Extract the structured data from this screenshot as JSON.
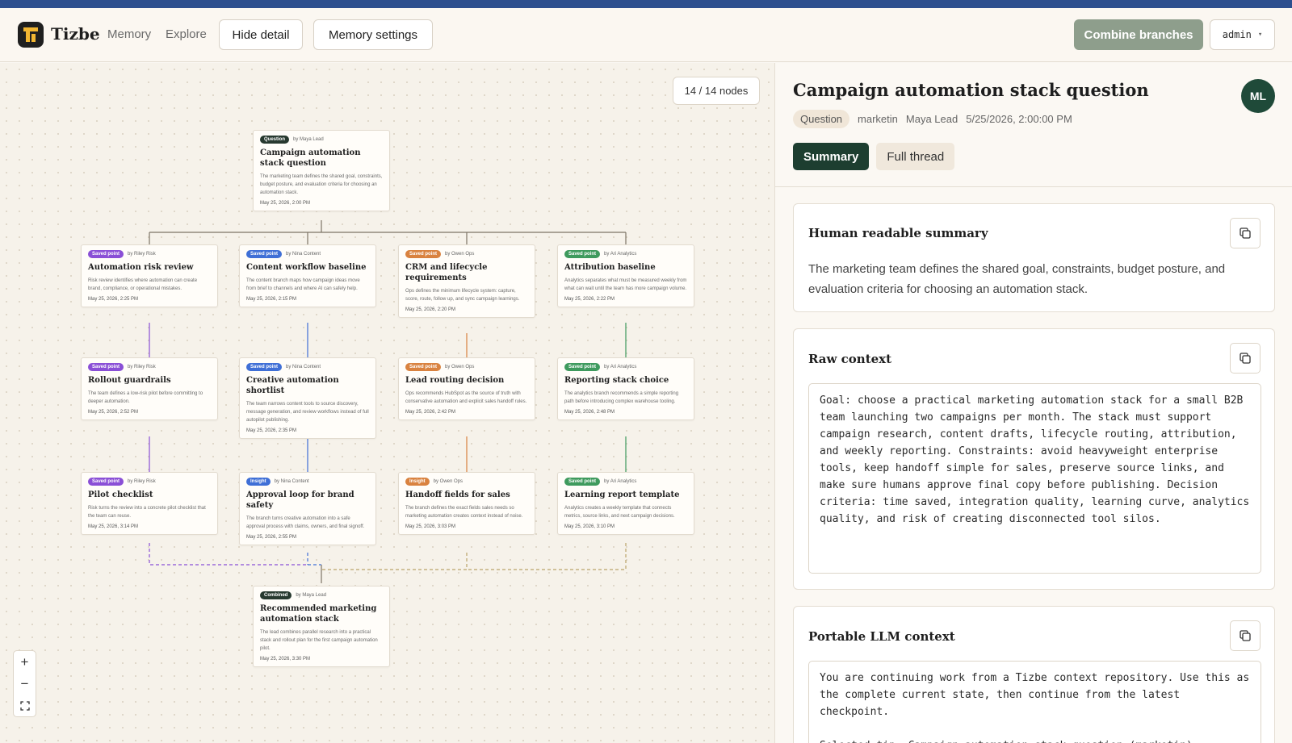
{
  "app": {
    "brand": "Tizbe"
  },
  "header": {
    "nav": [
      "Memory",
      "Explore"
    ],
    "hide_detail": "Hide detail",
    "memory_settings": "Memory settings",
    "combine": "Combine branches",
    "user": "admin"
  },
  "canvas": {
    "node_count": "14 / 14 nodes",
    "nodes": [
      {
        "badge": "Question",
        "badge_color": "#27392f",
        "by": "by Maya Lead",
        "title": "Campaign automation stack question",
        "body": "The marketing team defines the shared goal, constraints, budget posture, and evaluation criteria for choosing an automation stack.",
        "date": "May 25, 2026, 2:00 PM"
      },
      {
        "badge": "Saved point",
        "badge_color": "#8a4fd6",
        "by": "by Riley Risk",
        "title": "Automation risk review",
        "body": "Risk review identifies where automation can create brand, compliance, or operational mistakes.",
        "date": "May 25, 2026, 2:25 PM"
      },
      {
        "badge": "Saved point",
        "badge_color": "#3f6fd6",
        "by": "by Nina Content",
        "title": "Content workflow baseline",
        "body": "The content branch maps how campaign ideas move from brief to channels and where AI can safely help.",
        "date": "May 25, 2026, 2:15 PM"
      },
      {
        "badge": "Saved point",
        "badge_color": "#d9823f",
        "by": "by Owen Ops",
        "title": "CRM and lifecycle requirements",
        "body": "Ops defines the minimum lifecycle system: capture, score, route, follow up, and sync campaign learnings.",
        "date": "May 25, 2026, 2:20 PM"
      },
      {
        "badge": "Saved point",
        "badge_color": "#3e9a5d",
        "by": "by Ari Analytics",
        "title": "Attribution baseline",
        "body": "Analytics separates what must be measured weekly from what can wait until the team has more campaign volume.",
        "date": "May 25, 2026, 2:22 PM"
      },
      {
        "badge": "Saved point",
        "badge_color": "#8a4fd6",
        "by": "by Riley Risk",
        "title": "Rollout guardrails",
        "body": "The team defines a low-risk pilot before committing to deeper automation.",
        "date": "May 25, 2026, 2:52 PM"
      },
      {
        "badge": "Saved point",
        "badge_color": "#3f6fd6",
        "by": "by Nina Content",
        "title": "Creative automation shortlist",
        "body": "The team narrows content tools to source discovery, message generation, and review workflows instead of full autopilot publishing.",
        "date": "May 25, 2026, 2:35 PM"
      },
      {
        "badge": "Saved point",
        "badge_color": "#d9823f",
        "by": "by Owen Ops",
        "title": "Lead routing decision",
        "body": "Ops recommends HubSpot as the source of truth with conservative automation and explicit sales handoff rules.",
        "date": "May 25, 2026, 2:42 PM"
      },
      {
        "badge": "Saved point",
        "badge_color": "#3e9a5d",
        "by": "by Ari Analytics",
        "title": "Reporting stack choice",
        "body": "The analytics branch recommends a simple reporting path before introducing complex warehouse tooling.",
        "date": "May 25, 2026, 2:48 PM"
      },
      {
        "badge": "Saved point",
        "badge_color": "#8a4fd6",
        "by": "by Riley Risk",
        "title": "Pilot checklist",
        "body": "Risk turns the review into a concrete pilot checklist that the team can reuse.",
        "date": "May 25, 2026, 3:14 PM"
      },
      {
        "badge": "Insight",
        "badge_color": "#3f6fd6",
        "by": "by Nina Content",
        "title": "Approval loop for brand safety",
        "body": "The branch turns creative automation into a safe approval process with claims, owners, and final signoff.",
        "date": "May 25, 2026, 2:55 PM"
      },
      {
        "badge": "Insight",
        "badge_color": "#d9823f",
        "by": "by Owen Ops",
        "title": "Handoff fields for sales",
        "body": "The branch defines the exact fields sales needs so marketing automation creates context instead of noise.",
        "date": "May 25, 2026, 3:03 PM"
      },
      {
        "badge": "Saved point",
        "badge_color": "#3e9a5d",
        "by": "by Ari Analytics",
        "title": "Learning report template",
        "body": "Analytics creates a weekly template that connects metrics, source links, and next campaign decisions.",
        "date": "May 25, 2026, 3:10 PM"
      },
      {
        "badge": "Combined",
        "badge_color": "#27392f",
        "by": "by Maya Lead",
        "title": "Recommended marketing automation stack",
        "body": "The lead combines parallel research into a practical stack and rollout plan for the first campaign automation pilot.",
        "date": "May 25, 2026, 3:30 PM"
      }
    ]
  },
  "detail": {
    "title": "Campaign automation stack question",
    "avatar": "ML",
    "type": "Question",
    "branch": "marketin",
    "author": "Maya Lead",
    "timestamp": "5/25/2026, 2:00:00 PM",
    "tabs": [
      "Summary",
      "Full thread"
    ],
    "summary_title": "Human readable summary",
    "summary_text": "The marketing team defines the shared goal, constraints, budget posture, and evaluation criteria for choosing an automation stack.",
    "raw_title": "Raw context",
    "raw_text": "Goal: choose a practical marketing automation stack for a small B2B team launching two campaigns per month. The stack must support campaign research, content drafts, lifecycle routing, attribution, and weekly reporting. Constraints: avoid heavyweight enterprise tools, keep handoff simple for sales, preserve source links, and make sure humans approve final copy before publishing. Decision criteria: time saved, integration quality, learning curve, analytics quality, and risk of creating disconnected tool silos.",
    "llm_title": "Portable LLM context",
    "llm_text": "You are continuing work from a Tizbe context repository. Use this as the complete current state, then continue from the latest checkpoint.\n\nSelected tip: Campaign automation stack question (marketin)"
  },
  "colors": {
    "accent": "#1d3e30",
    "combine": "#8e9e8c",
    "risk": "#8a4fd6",
    "content": "#3f6fd6",
    "ops": "#d9823f",
    "analytics": "#3e9a5d"
  },
  "icons": [
    "logo-icon",
    "chevron-down-icon",
    "copy-icon",
    "zoom-in-icon",
    "zoom-out-icon",
    "fit-view-icon"
  ]
}
